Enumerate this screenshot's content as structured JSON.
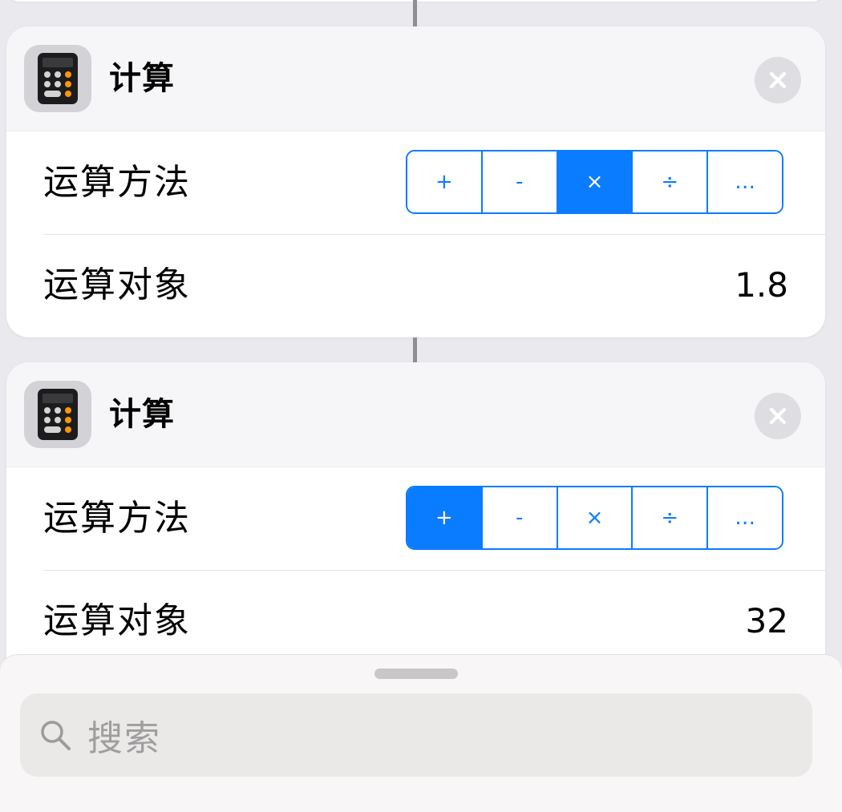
{
  "actions": [
    {
      "title": "计算",
      "operation_label": "运算方法",
      "operators": [
        "+",
        "-",
        "×",
        "÷",
        "…"
      ],
      "selected_operator": "×",
      "operand_label": "运算对象",
      "operand_value": "1.8"
    },
    {
      "title": "计算",
      "operation_label": "运算方法",
      "operators": [
        "+",
        "-",
        "×",
        "÷",
        "…"
      ],
      "selected_operator": "+",
      "operand_label": "运算对象",
      "operand_value": "32"
    }
  ],
  "search": {
    "placeholder": "搜索"
  },
  "icons": {
    "app": "calculator-icon",
    "remove": "close-icon",
    "search": "search-icon"
  },
  "colors": {
    "accent": "#0a7cff",
    "calculator_orange": "#ff9500"
  }
}
